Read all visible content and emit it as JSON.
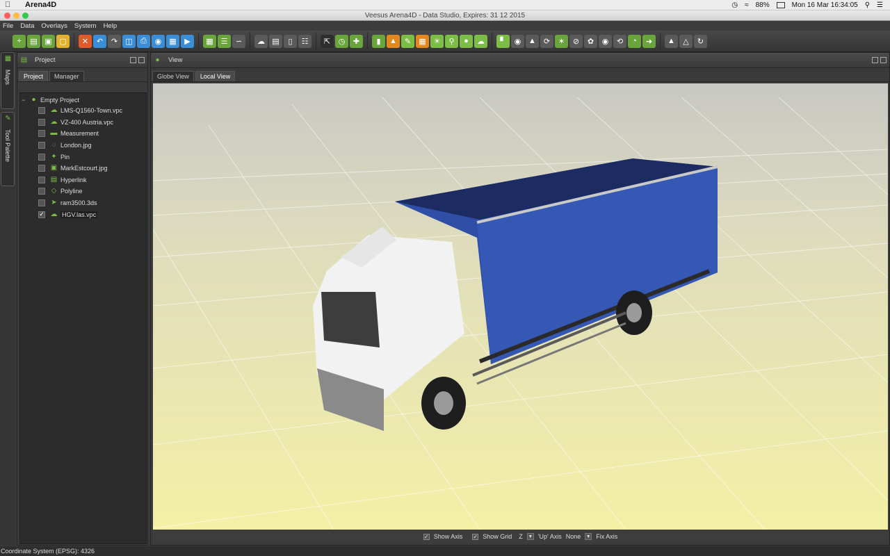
{
  "macos": {
    "app_name": "Arena4D",
    "battery": "88%",
    "datetime": "Mon 16 Mar  16:34:05"
  },
  "window": {
    "title": "Veesus Arena4D - Data Studio, Expires: 31 12 2015"
  },
  "menu": [
    "File",
    "Data",
    "Overlays",
    "System",
    "Help"
  ],
  "side_tabs": {
    "maps": "Maps",
    "tool_palette": "Tool Palette"
  },
  "project_panel": {
    "title": "Project",
    "tabs": [
      "Project",
      "Manager"
    ],
    "root": "Empty Project",
    "items": [
      {
        "label": "LMS-Q1560-Town.vpc",
        "icon": "point-cloud-icon",
        "checked": false
      },
      {
        "label": "VZ-400 Austria.vpc",
        "icon": "point-cloud-icon",
        "checked": false
      },
      {
        "label": "Measurement",
        "icon": "ruler-icon",
        "checked": false
      },
      {
        "label": "London.jpg",
        "icon": "image-icon",
        "checked": false
      },
      {
        "label": "Pin",
        "icon": "pin-icon",
        "checked": false
      },
      {
        "label": "MarkEstcourt.jpg",
        "icon": "photo-icon",
        "checked": false
      },
      {
        "label": "Hyperlink",
        "icon": "hyperlink-icon",
        "checked": false
      },
      {
        "label": "Polyline",
        "icon": "polyline-icon",
        "checked": false
      },
      {
        "label": "ram3500.3ds",
        "icon": "model-icon",
        "checked": false
      },
      {
        "label": "HGV.las.vpc",
        "icon": "point-cloud-icon",
        "checked": true
      }
    ]
  },
  "view_panel": {
    "title": "View",
    "tabs": [
      "Globe View",
      "Local View"
    ],
    "active_tab": "Local View"
  },
  "view_footer": {
    "show_axis": "Show Axis",
    "show_grid": "Show Grid",
    "up_axis_value": "Z",
    "up_axis_label": "'Up' Axis",
    "fix_axis_value": "None",
    "fix_axis_label": "Fix Axis"
  },
  "status": {
    "text": "Coordinate System (EPSG): 4326"
  },
  "colors": {
    "accent_green": "#7cbd45",
    "truck_blue": "#2f4ea6",
    "floor_yellow": "#f4f0a6"
  }
}
